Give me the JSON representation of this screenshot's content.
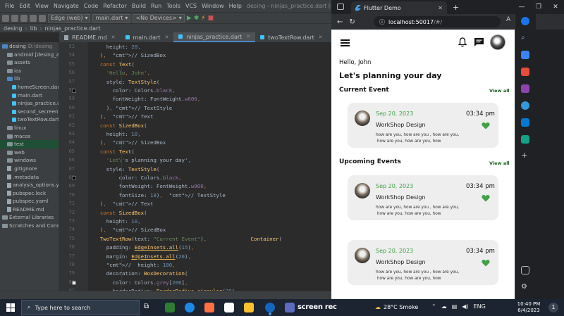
{
  "ide": {
    "menu": [
      "File",
      "Edit",
      "View",
      "Navigate",
      "Code",
      "Refactor",
      "Build",
      "Run",
      "Tools",
      "VCS",
      "Window",
      "Help"
    ],
    "title": "desing - ninjas_practice.dart [desing]",
    "toolbar": {
      "device_target": "Edge (web)",
      "run_config": "main.dart",
      "devices": "<No Devices>"
    },
    "breadcrumb": [
      "desing",
      "lib",
      "ninjas_practice.dart"
    ],
    "tabs": [
      {
        "label": "README.md",
        "active": false
      },
      {
        "label": "main.dart",
        "active": false
      },
      {
        "label": "ninjas_practice.dart",
        "active": true
      },
      {
        "label": "twoTextRow.dart",
        "active": false
      }
    ],
    "project_tree": [
      {
        "label": "desing",
        "note": "D:\\desing",
        "level": 0,
        "kind": "folder-blue",
        "state": "normal"
      },
      {
        "label": "android [desing_and",
        "note": "",
        "level": 1,
        "kind": "folder",
        "state": "normal"
      },
      {
        "label": "assets",
        "note": "",
        "level": 1,
        "kind": "folder",
        "state": "normal"
      },
      {
        "label": "ios",
        "note": "",
        "level": 1,
        "kind": "folder",
        "state": "normal"
      },
      {
        "label": "lib",
        "note": "",
        "level": 1,
        "kind": "folder-blue",
        "state": "normal"
      },
      {
        "label": "homeScreen.dart",
        "note": "",
        "level": 2,
        "kind": "dart",
        "state": "normal"
      },
      {
        "label": "main.dart",
        "note": "",
        "level": 2,
        "kind": "dart",
        "state": "normal"
      },
      {
        "label": "ninjas_practice.da",
        "note": "",
        "level": 2,
        "kind": "dart",
        "state": "normal"
      },
      {
        "label": "second_secreen.d",
        "note": "",
        "level": 2,
        "kind": "dart",
        "state": "normal"
      },
      {
        "label": "twoTextRow.dart",
        "note": "",
        "level": 2,
        "kind": "dart",
        "state": "normal"
      },
      {
        "label": "linux",
        "note": "",
        "level": 1,
        "kind": "folder",
        "state": "normal"
      },
      {
        "label": "macos",
        "note": "",
        "level": 1,
        "kind": "folder",
        "state": "normal"
      },
      {
        "label": "test",
        "note": "",
        "level": 1,
        "kind": "folder",
        "state": "highlight"
      },
      {
        "label": "web",
        "note": "",
        "level": 1,
        "kind": "folder",
        "state": "normal"
      },
      {
        "label": "windows",
        "note": "",
        "level": 1,
        "kind": "folder",
        "state": "normal"
      },
      {
        "label": ".gitignore",
        "note": "",
        "level": 1,
        "kind": "file",
        "state": "normal"
      },
      {
        "label": ".metadata",
        "note": "",
        "level": 1,
        "kind": "file",
        "state": "normal"
      },
      {
        "label": "analysis_options.yar",
        "note": "",
        "level": 1,
        "kind": "file",
        "state": "normal"
      },
      {
        "label": "pubspec.lock",
        "note": "",
        "level": 1,
        "kind": "file",
        "state": "normal"
      },
      {
        "label": "pubspec.yaml",
        "note": "",
        "level": 1,
        "kind": "file",
        "state": "normal"
      },
      {
        "label": "README.md",
        "note": "",
        "level": 1,
        "kind": "file",
        "state": "normal"
      },
      {
        "label": "External Libraries",
        "note": "",
        "level": 0,
        "kind": "folder",
        "state": "normal"
      },
      {
        "label": "Scratches and Consoles",
        "note": "",
        "level": 0,
        "kind": "folder",
        "state": "normal"
      }
    ],
    "line_numbers": [
      53,
      54,
      55,
      56,
      57,
      58,
      59,
      60,
      61,
      62,
      63,
      64,
      65,
      66,
      67,
      68,
      69,
      70,
      71,
      72,
      73,
      74,
      75,
      76,
      77,
      78,
      79,
      80,
      81
    ],
    "code_lines": [
      "      height: 20,",
      "    ),  // SizedBox",
      "    const Text(",
      "      'Hello, John',",
      "      style: TextStyle(",
      "        color: Colors.black,",
      "        fontWeight: FontWeight.w600,",
      "      ), // TextStyle",
      "    ),  // Text",
      "    const SizedBox(",
      "      height: 10,",
      "    ),  // SizedBox",
      "    const Text(",
      "      'Let\\'s planning your day',",
      "      style: TextStyle(",
      "          color: Colors.black,",
      "          fontWeight: FontWeight.w900,",
      "          fontSize: 18),  // TextStyle",
      "    ),  // Text",
      "    const SizedBox(",
      "      height: 10,",
      "    ),  // SizedBox",
      "    TwoTextRow(text: \"Current Event\"),              Container(",
      "      padding: EdgeInsets.all(15),",
      "      margin: EdgeInsets.all(20),",
      "      //  height: 100,",
      "      decoration: BoxDecoration(",
      "        color: Colors.grey[200],",
      "        borderRadius: BorderRadius.circular(20),"
    ]
  },
  "browser": {
    "tab_title": "Flutter Demo",
    "url_prefix": "ⓘ",
    "url_host": "localhost:50017",
    "url_path": "/#/"
  },
  "app": {
    "greeting": "Hello, John",
    "headline": "Let's planning your day",
    "current_section": {
      "title": "Current Event",
      "view_all": "View all"
    },
    "upcoming_section": {
      "title": "Upcoming Events",
      "view_all": "View all"
    },
    "events": [
      {
        "date": "Sep 20, 2023",
        "time": "03:34 pm",
        "title": "WorkShop Design",
        "description": "how are you, how are you , how are you,\n how are you, how are you, how"
      },
      {
        "date": "Sep 20, 2023",
        "time": "03:34 pm",
        "title": "WorkShop Design",
        "description": "how are you, how are you , how are you,\n how are you, how are you, how"
      },
      {
        "date": "Sep 20, 2023",
        "time": "03:34 pm",
        "title": "WorkShop Design",
        "description": "how are you, how are you , how are you,\n how are you, how are you, how"
      }
    ],
    "accent_color": "#43a047",
    "card_color": "#eeeeee"
  },
  "taskbar": {
    "search_placeholder": "Type here to search",
    "screenrec_label": "screen rec",
    "weather": "28°C  Smoke",
    "language": "ENG",
    "time": "10:40 PM",
    "date": "6/4/2023",
    "notifications": "1"
  }
}
